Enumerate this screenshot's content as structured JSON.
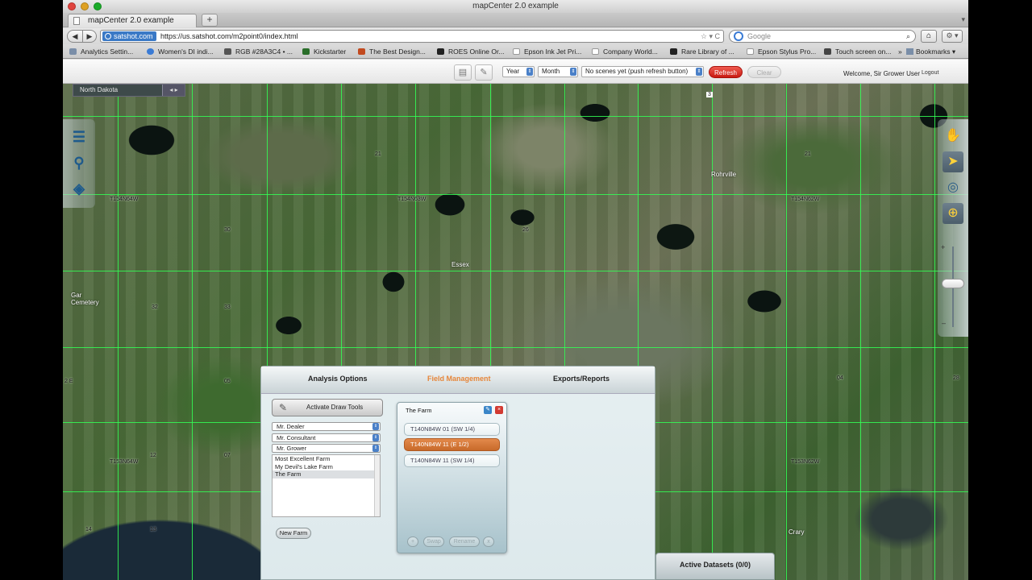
{
  "window": {
    "title": "mapCenter 2.0 example"
  },
  "tab": {
    "title": "mapCenter 2.0 example",
    "new_tab": "+",
    "end": "▾"
  },
  "toolbar": {
    "back": "◀",
    "forward": "▶",
    "site": "satshot.com",
    "url": "https://us.satshot.com/m2point0/index.html",
    "url_actions": "☆ ▾ C",
    "search_placeholder": "Google",
    "search_icon": "search-icon",
    "home": "⌂",
    "settings": "⚙ ▾"
  },
  "bookmarks": {
    "items": [
      {
        "label": "Analytics Settin...",
        "color": "#7a8ea8"
      },
      {
        "label": "Women's DI indi...",
        "color": "#3a7bd5"
      },
      {
        "label": "RGB #28A3C4 • ...",
        "color": "#555555"
      },
      {
        "label": "Kickstarter",
        "color": "#2a6e2a"
      },
      {
        "label": "The Best Design...",
        "color": "#c24a1f"
      },
      {
        "label": "ROES Online Or...",
        "color": "#222222"
      },
      {
        "label": "Epson Ink Jet Pri...",
        "color": "#ffffff"
      },
      {
        "label": "Company World...",
        "color": "#ffffff"
      },
      {
        "label": "Rare Library of ...",
        "color": "#222222"
      },
      {
        "label": "Epson Stylus Pro...",
        "color": "#ffffff"
      },
      {
        "label": "Touch screen on...",
        "color": "#444444"
      }
    ],
    "more": "»",
    "folder": "Bookmarks ▾"
  },
  "appbar": {
    "year": "Year",
    "month": "Month",
    "scenes": "No scenes yet (push refresh button)",
    "refresh": "Refresh",
    "clear": "Clear",
    "welcome": "Welcome, Sir Grower User",
    "logout": "Logout",
    "select_arrow": "⇕"
  },
  "map": {
    "region_tab": "North Dakota",
    "region_ctl": "◂ ▸",
    "labels": {
      "rohrville": "Rohrville",
      "essex": "Essex",
      "cemetery": "Gar\nCemetery",
      "crary": "Crary",
      "t1": "T154N64W",
      "t2": "T154N63W",
      "t3": "T154N62W",
      "t4": "T153N62W",
      "t5": "T153N64W",
      "road3": "3",
      "s21": "21",
      "s26": "26",
      "s28": "28",
      "s30": "30",
      "s32": "32",
      "s33": "33",
      "s05": "05",
      "s04": "04",
      "s12": "12",
      "s07": "07",
      "s14": "14",
      "s11": "11",
      "s16": "16",
      "s13": "13",
      "s2e": "2 E"
    }
  },
  "left_tools": {
    "list": "☰",
    "search": "⚲",
    "layers": "◈"
  },
  "right_tools": {
    "pan": "✋",
    "select": "➤",
    "compass": "◎",
    "zoom": "⊕",
    "plus": "+",
    "minus": "–"
  },
  "panel": {
    "tabs": [
      "Analysis Options",
      "Field Management",
      "Exports/Reports"
    ],
    "draw_tools": "Activate Draw Tools",
    "draw_icon": "✎",
    "dealer": "Mr. Dealer",
    "consultant": "Mr. Consultant",
    "grower": "Mr. Grower",
    "select_arrow": "⇕",
    "farms": [
      "Most Excellent Farm",
      "My Devil's Lake Farm",
      "The Farm"
    ],
    "new_farm": "New Farm"
  },
  "farm_card": {
    "title": "The Farm",
    "edit": "✎",
    "delete": "×",
    "fields": [
      "T140N84W 01 (SW 1/4)",
      "T140N84W 11 (E 1/2)",
      "T140N84W 11 (SW 1/4)"
    ],
    "add": "+",
    "swap": "Swap",
    "rename": "Rename",
    "remove": "x"
  },
  "active_datasets": "Active Datasets (0/0)"
}
